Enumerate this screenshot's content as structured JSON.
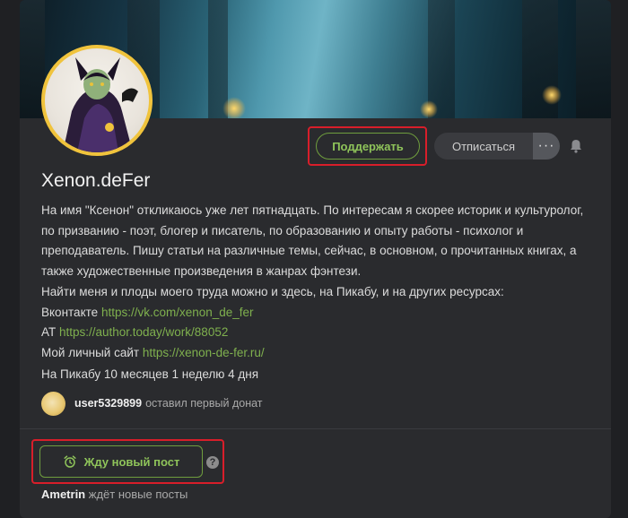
{
  "profile": {
    "name": "Xenon.deFer",
    "support_label": "Поддержать",
    "unsubscribe_label": "Отписаться",
    "more_label": "···",
    "bio_lines": [
      "На имя \"Ксенон\" откликаюсь уже лет пятнадцать. По интересам я скорее историк и культуролог,",
      "по призванию - поэт, блогер и писатель, по образованию и опыту работы - психолог и",
      "преподаватель. Пишу статьи на различные темы, сейчас, в основном, о прочитанных книгах, а",
      "также художественные произведения в жанрах фэнтези.",
      "Найти меня и плоды моего труда можно и здесь, на Пикабу, и на других ресурсах:"
    ],
    "links": [
      {
        "label": "Вконтакте",
        "url": "https://vk.com/xenon_de_fer"
      },
      {
        "label": "АТ",
        "url": "https://author.today/work/88052"
      },
      {
        "label": "Мой личный сайт",
        "url": "https://xenon-de-fer.ru/"
      }
    ],
    "duration": "На Пикабу 10 месяцев 1 неделю 4 дня"
  },
  "donor": {
    "username": "user5329899",
    "text": "оставил первый донат"
  },
  "wait": {
    "button_label": "Жду новый пост",
    "help": "?",
    "waiter_name": "Ametrin",
    "waiter_text": "ждёт новые посты"
  },
  "colors": {
    "accent_green": "#8fc45a",
    "link_green": "#7fb04e",
    "highlight_red": "#d81e2a",
    "avatar_ring": "#f0c33c"
  }
}
